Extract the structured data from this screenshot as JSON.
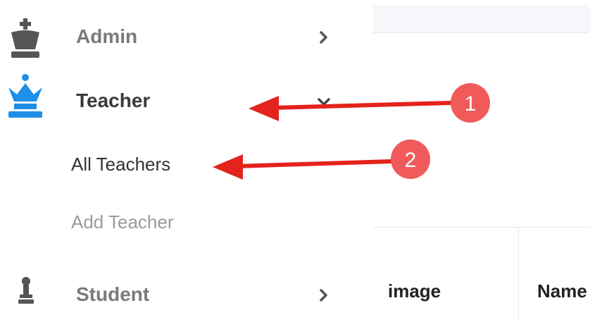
{
  "sidebar": {
    "items": [
      {
        "label": "Admin",
        "icon": "chess-king-icon",
        "icon_color": "#555555",
        "chevron": "chevron-right-icon"
      },
      {
        "label": "Teacher",
        "icon": "chess-queen-icon",
        "icon_color": "#1e90e8",
        "chevron": "chevron-down-icon",
        "expanded": true,
        "subitems": [
          {
            "label": "All Teachers",
            "active": true
          },
          {
            "label": "Add Teacher",
            "active": false
          }
        ]
      },
      {
        "label": "Student",
        "icon": "chess-pawn-icon",
        "icon_color": "#555555",
        "chevron": "chevron-right-icon"
      }
    ]
  },
  "table": {
    "headers": [
      "image",
      "Name"
    ]
  },
  "annotations": [
    {
      "number": "1",
      "color": "#f05a5a",
      "arrow_color": "#e3231c"
    },
    {
      "number": "2",
      "color": "#f05a5a",
      "arrow_color": "#e3231c"
    }
  ]
}
